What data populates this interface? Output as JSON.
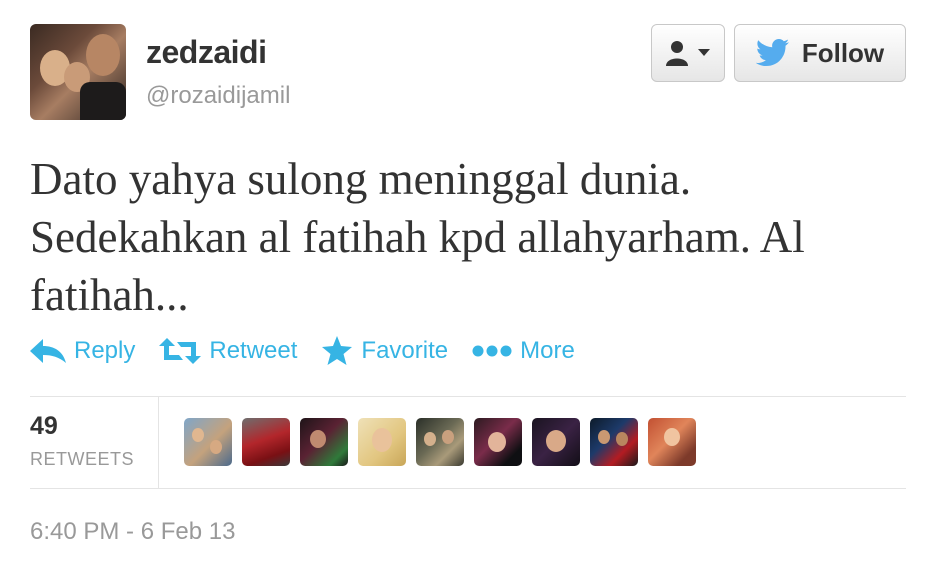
{
  "author": {
    "display_name": "zedzaidi",
    "username": "@rozaidijamil"
  },
  "header_buttons": {
    "user_menu_icon": "person-dropdown-icon",
    "follow_label": "Follow",
    "follow_icon": "twitter-bird-icon"
  },
  "tweet": {
    "text": "Dato yahya sulong meninggal dunia. Sedekahkan al fatihah kpd allahyarham. Al fatihah..."
  },
  "actions": [
    {
      "label": "Reply",
      "icon": "reply-arrow-icon"
    },
    {
      "label": "Retweet",
      "icon": "retweet-icon"
    },
    {
      "label": "Favorite",
      "icon": "star-icon"
    },
    {
      "label": "More",
      "icon": "ellipsis-dots-icon"
    }
  ],
  "stats": {
    "retweet_count": "49",
    "retweet_label": "RETWEETS",
    "retweeter_avatar_count": 9
  },
  "timestamp": "6:40 PM - 6 Feb 13",
  "colors": {
    "link_blue": "#36b4e4",
    "twitter_blue": "#55acee",
    "muted_text": "#999999",
    "primary_text": "#333333"
  }
}
